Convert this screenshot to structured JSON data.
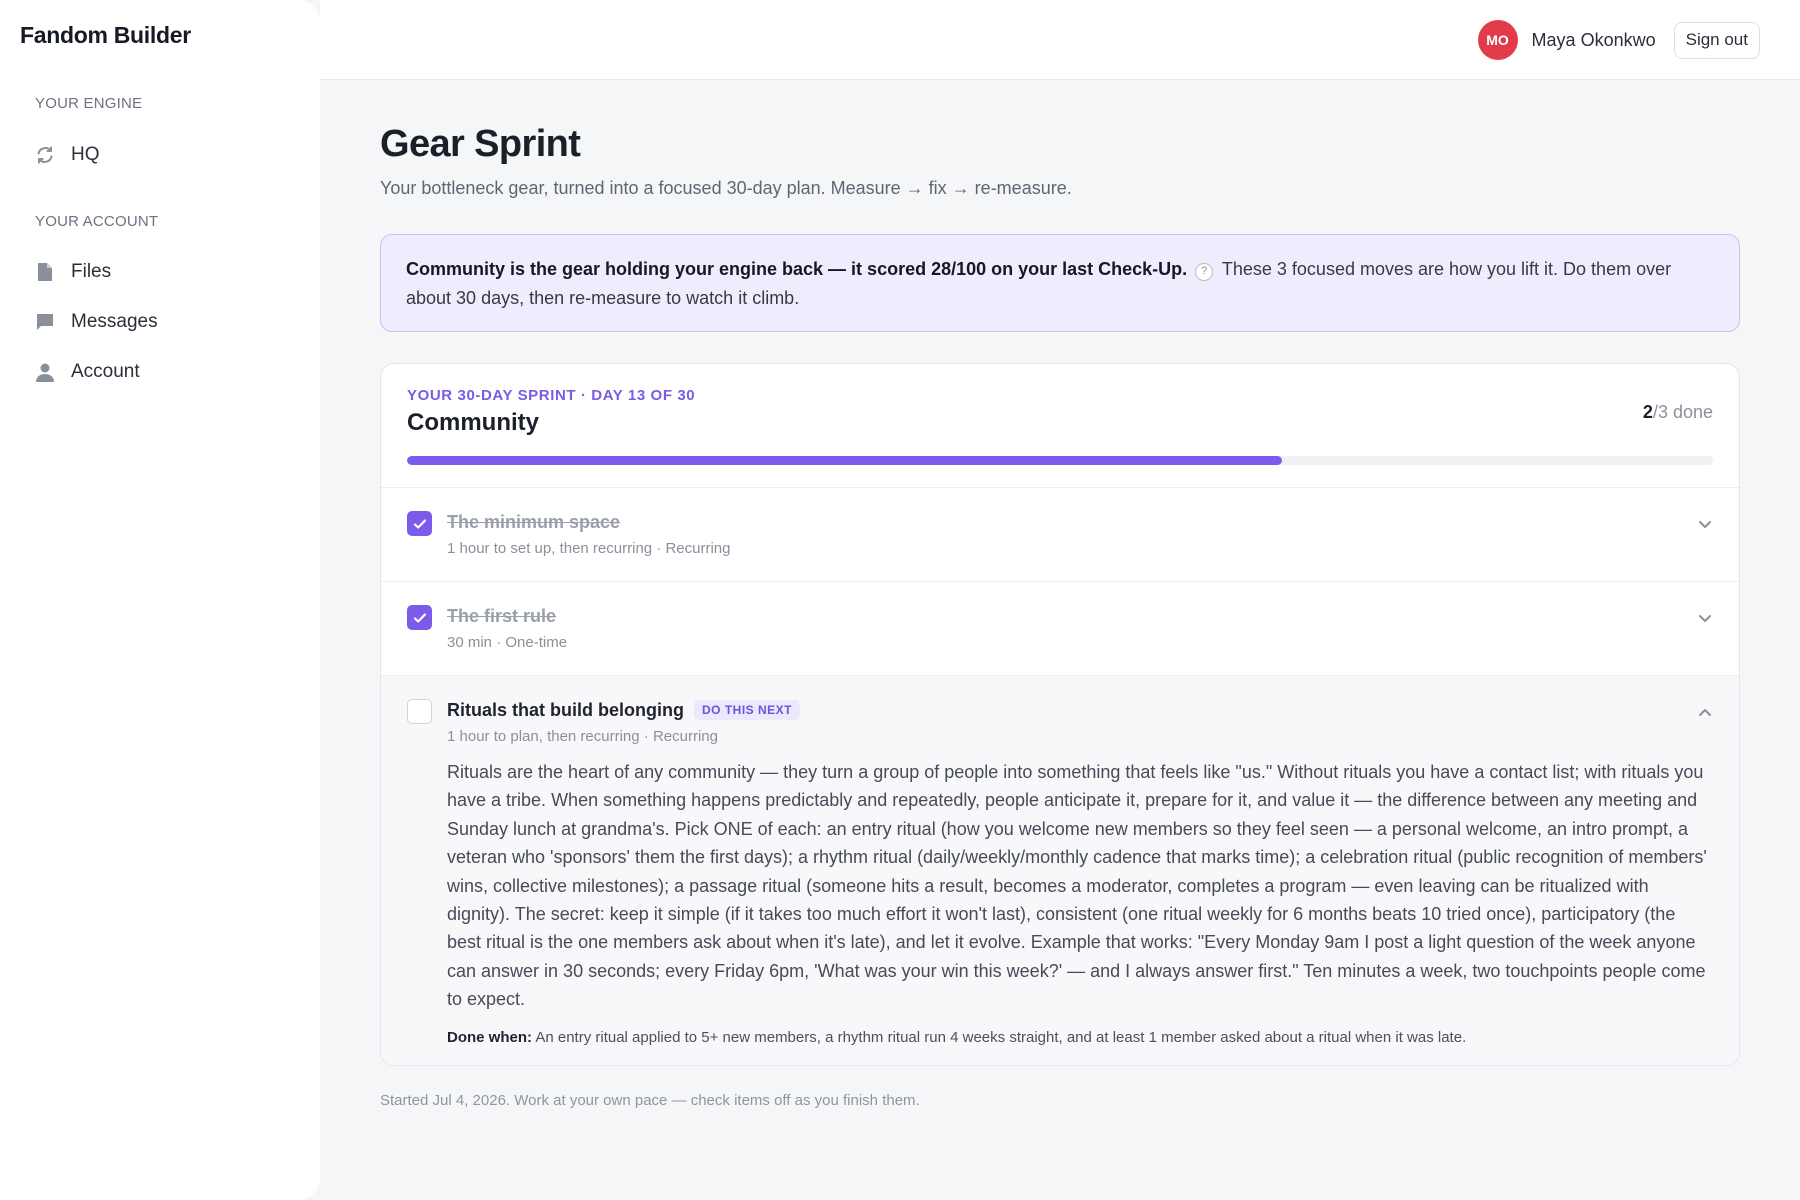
{
  "app": {
    "brand": "Fandom Builder"
  },
  "sidebar": {
    "sections": [
      {
        "label": "YOUR ENGINE"
      },
      {
        "label": "YOUR ACCOUNT"
      }
    ],
    "items": [
      {
        "label": "HQ",
        "icon": "refresh-icon"
      },
      {
        "label": "Files",
        "icon": "file-icon"
      },
      {
        "label": "Messages",
        "icon": "message-icon"
      },
      {
        "label": "Account",
        "icon": "user-icon"
      }
    ]
  },
  "topbar": {
    "avatar_initials": "MO",
    "avatar_color": "#e23b4a",
    "user_name": "Maya Okonkwo",
    "signout_label": "Sign out"
  },
  "page": {
    "title": "Gear Sprint",
    "subtitle": "Your bottleneck gear, turned into a focused 30-day plan. Measure → fix → re-measure."
  },
  "banner": {
    "strong": "Community is the gear holding your engine back — it scored 28/100 on your last Check-Up.",
    "help_icon_label": "?",
    "rest": "These 3 focused moves are how you lift it. Do them over about 30 days, then re-measure to watch it climb."
  },
  "sprint": {
    "kicker": "YOUR 30-DAY SPRINT · DAY 13 OF 30",
    "name": "Community",
    "done_count": "2",
    "total_suffix": "/3 done",
    "progress": 0.67,
    "accent_color": "#7b5be9",
    "tasks": [
      {
        "title": "The minimum space",
        "meta": "1 hour to set up, then recurring · Recurring",
        "done": true
      },
      {
        "title": "The first rule",
        "meta": "30 min · One-time",
        "done": true
      },
      {
        "title": "Rituals that build belonging",
        "badge": "DO THIS NEXT",
        "meta": "1 hour to plan, then recurring · Recurring",
        "done": false,
        "body": "Rituals are the heart of any community — they turn a group of people into something that feels like \"us.\" Without rituals you have a contact list; with rituals you have a tribe. When something happens predictably and repeatedly, people anticipate it, prepare for it, and value it — the difference between any meeting and Sunday lunch at grandma's. Pick ONE of each: an entry ritual (how you welcome new members so they feel seen — a personal welcome, an intro prompt, a veteran who 'sponsors' them the first days); a rhythm ritual (daily/weekly/monthly cadence that marks time); a celebration ritual (public recognition of members' wins, collective milestones); a passage ritual (someone hits a result, becomes a moderator, completes a program — even leaving can be ritualized with dignity). The secret: keep it simple (if it takes too much effort it won't last), consistent (one ritual weekly for 6 months beats 10 tried once), participatory (the best ritual is the one members ask about when it's late), and let it evolve. Example that works: \"Every Monday 9am I post a light question of the week anyone can answer in 30 seconds; every Friday 6pm, 'What was your win this week?' — and I always answer first.\" Ten minutes a week, two touchpoints people come to expect.",
        "done_when_label": "Done when:",
        "done_when": "An entry ritual applied to 5+ new members, a rhythm ritual run 4 weeks straight, and at least 1 member asked about a ritual when it was late."
      }
    ]
  },
  "footnote": "Started Jul 4, 2026. Work at your own pace — check items off as you finish them."
}
